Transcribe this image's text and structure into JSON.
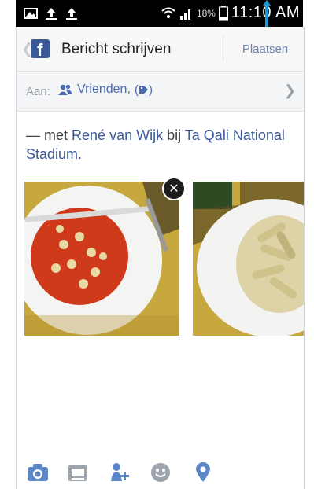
{
  "statusbar": {
    "battery_percent": "18%",
    "time": "11:10 AM",
    "icons": [
      "gallery-icon",
      "upload-icon",
      "upload-icon",
      "wifi-icon",
      "signal-icon",
      "battery-icon"
    ]
  },
  "header": {
    "title": "Bericht schrijven",
    "post_button": "Plaatsen"
  },
  "audience": {
    "label": "Aan:",
    "value": "Vrienden,"
  },
  "composer": {
    "with_prefix": "— met",
    "friend": "René van Wijk",
    "at_word": "bij",
    "place": "Ta Qali National Stadium."
  },
  "photos": [
    {
      "description": "pasta with tomato sauce",
      "removable": true
    },
    {
      "description": "penne pasta",
      "removable": false
    }
  ],
  "toolbar": {
    "buttons": [
      "camera-icon",
      "album-icon",
      "tag-friend-icon",
      "emoji-icon",
      "location-icon"
    ]
  },
  "colors": {
    "facebook_blue": "#3b5998",
    "link_blue": "#4a6ab1",
    "toolbar_blue": "#5b86c8"
  }
}
